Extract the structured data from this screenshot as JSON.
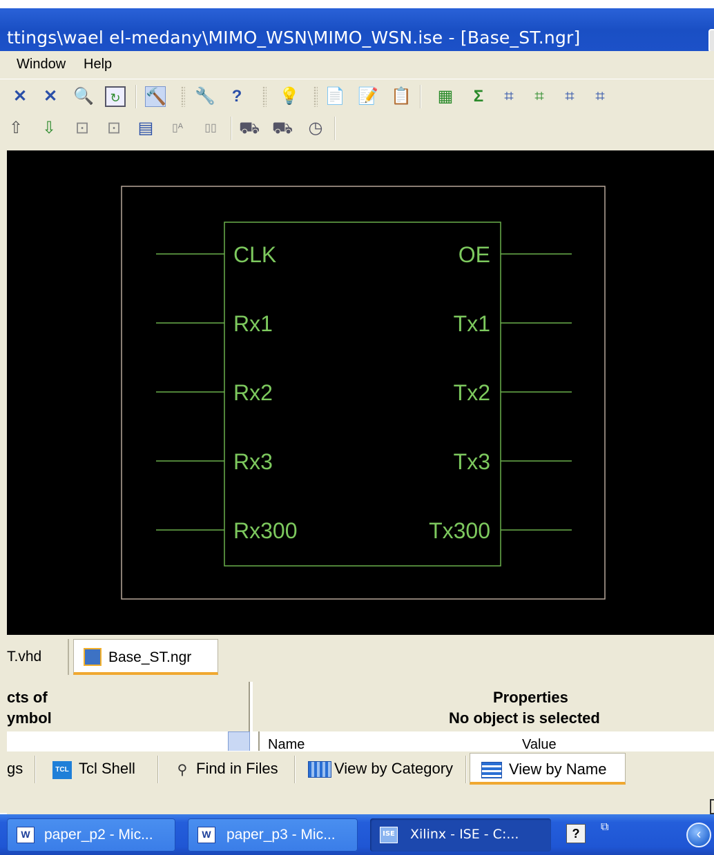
{
  "window": {
    "title": "ttings\\wael el-medany\\MIMO_WSN\\MIMO_WSN.ise - [Base_ST.ngr]"
  },
  "menu": {
    "items": [
      "Window",
      "Help"
    ]
  },
  "toolbar": {
    "row1_icons": [
      "zoom-full-icon",
      "zoom-fit-icon",
      "find-icon",
      "refresh-icon",
      "hammer-icon",
      "wrench-icon",
      "whats-this-icon",
      "lightbulb-icon",
      "document-icon",
      "edit-document-icon",
      "report-icon",
      "chip-icon",
      "sigma-icon",
      "schematic-icon",
      "schematic-2-icon",
      "schematic-3-icon",
      "schematic-4-icon"
    ],
    "row2_icons": [
      "up-icon",
      "down-icon",
      "push-icon",
      "pop-icon",
      "page-icon",
      "pin-a-icon",
      "pin-b-icon",
      "cart-icon",
      "cart-2-icon",
      "clock-icon"
    ]
  },
  "schematic": {
    "colors": {
      "line": "#6ab04c",
      "text": "#7dc95e",
      "frame": "#b8a89a",
      "background": "#000000"
    },
    "inputs": [
      "CLK",
      "Rx1",
      "Rx2",
      "Rx3",
      "Rx300"
    ],
    "outputs": [
      "OE",
      "Tx1",
      "Tx2",
      "Tx3",
      "Tx300"
    ]
  },
  "doc_tabs": {
    "vhd": "T.vhd",
    "ngr": "Base_ST.ngr"
  },
  "properties": {
    "left_line1": "cts of",
    "left_line2": "ymbol",
    "title": "Properties",
    "subtitle": "No object is selected",
    "col_name": "Name",
    "col_value": "Value"
  },
  "console_tabs": {
    "partial": "gs",
    "tcl_icon": "TCL",
    "tcl": "Tcl Shell",
    "find": "Find in Files",
    "category": "View by Category",
    "byname": "View by Name"
  },
  "taskbar": {
    "btn1": "paper_p2 - Mic...",
    "btn2": "paper_p3 - Mic...",
    "btn3": "Xilinx - ISE - C:...",
    "ise_icon": "ISE",
    "help_icon": "?",
    "back_icon": "‹"
  }
}
